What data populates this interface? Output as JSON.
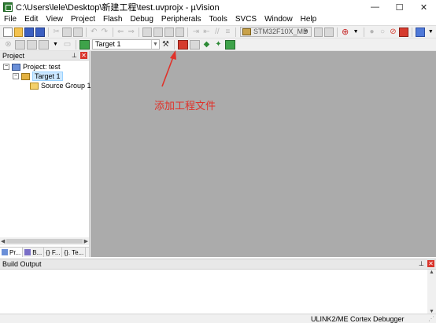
{
  "window": {
    "title": "C:\\Users\\lele\\Desktop\\新建工程\\test.uvprojx - µVision",
    "controls": {
      "minimize": "—",
      "maximize": "☐",
      "close": "✕"
    }
  },
  "menu": [
    "File",
    "Edit",
    "View",
    "Project",
    "Flash",
    "Debug",
    "Peripherals",
    "Tools",
    "SVCS",
    "Window",
    "Help"
  ],
  "toolbar": {
    "device": "STM32F10X_MD",
    "target": "Target 1"
  },
  "project_pane": {
    "title": "Project",
    "tree": {
      "root": "Project: test",
      "target": "Target 1",
      "group": "Source Group 1"
    },
    "tabs": [
      "Pr...",
      "B...",
      "{} F...",
      "{}. Te..."
    ]
  },
  "annotation": "添加工程文件",
  "build_output": {
    "title": "Build Output"
  },
  "status": {
    "debugger": "ULINK2/ME Cortex Debugger"
  },
  "colors": {
    "annotation": "#e0322a",
    "editor_bg": "#ababab",
    "close_btn": "#d9342b"
  }
}
